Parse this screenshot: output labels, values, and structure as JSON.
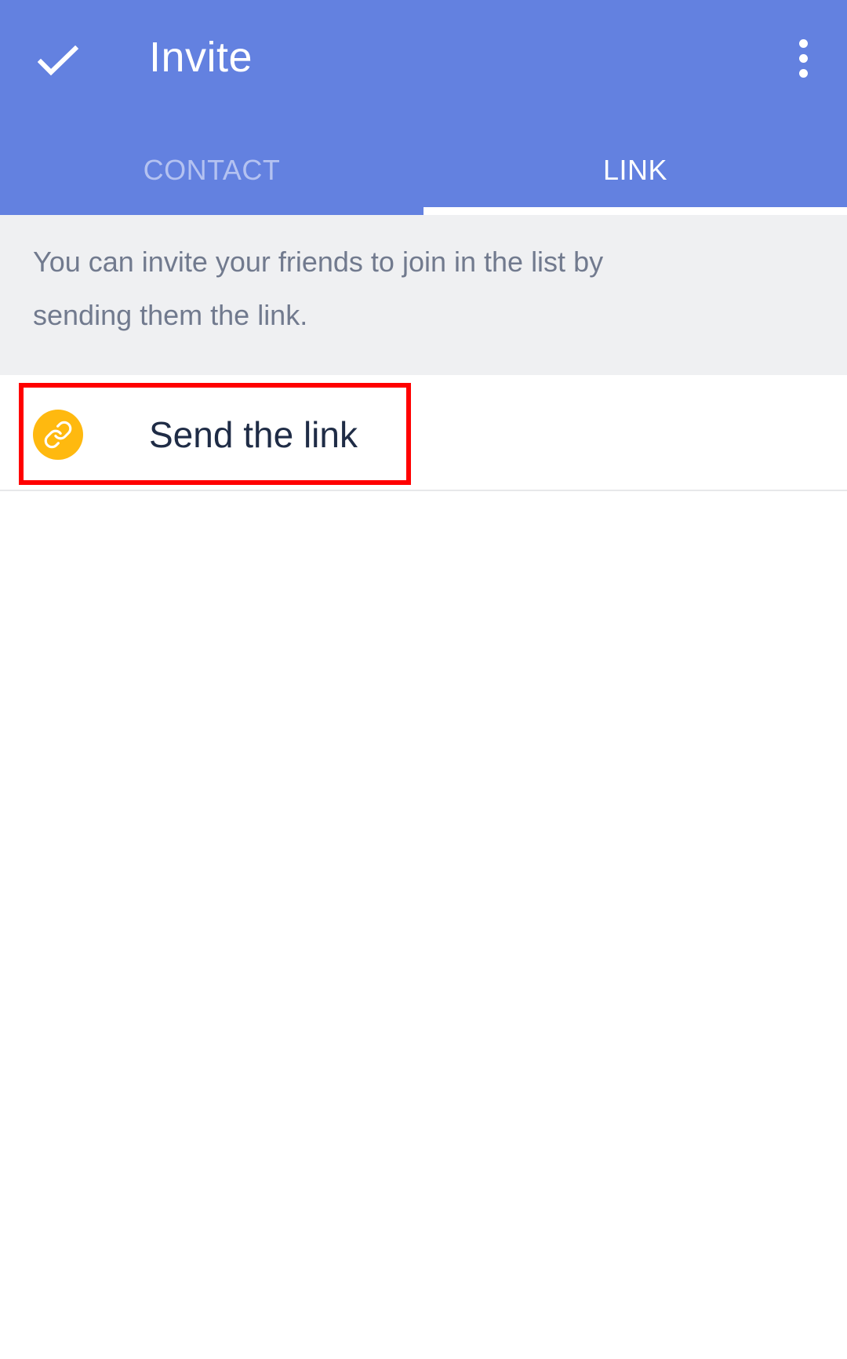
{
  "header": {
    "title": "Invite",
    "check_icon": "check-icon",
    "overflow_icon": "more-vert-icon",
    "background_color": "#6381e0"
  },
  "tabs": [
    {
      "label": "CONTACT",
      "selected": false
    },
    {
      "label": "LINK",
      "selected": true
    }
  ],
  "description": {
    "text": "You can invite your friends to join in the list by sending them the link."
  },
  "link_action": {
    "label": "Send the link",
    "icon": "link-icon",
    "icon_color": "#ffb90f",
    "highlight_color": "#ff0000"
  }
}
